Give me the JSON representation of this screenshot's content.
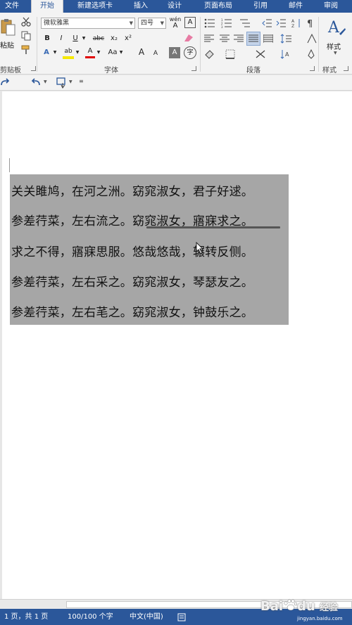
{
  "tabs": {
    "file": "文件",
    "home": "开始",
    "new_tab": "新建选项卡",
    "insert": "插入",
    "design": "设计",
    "layout": "页面布局",
    "references": "引用",
    "mailings": "邮件",
    "review": "审阅"
  },
  "ribbon": {
    "clipboard": {
      "paste_label": "粘贴",
      "group_label": "剪贴板"
    },
    "font": {
      "font_name": "微软雅黑",
      "font_size": "四号",
      "bold": "B",
      "italic": "I",
      "underline": "U",
      "strike": "abc",
      "subscript": "x₂",
      "superscript": "x²",
      "grow": "A",
      "shrink": "A",
      "clear": "A",
      "phonetic": "wén",
      "char_border": "A",
      "char_shading": "A",
      "enclose": "字",
      "font_color": "A",
      "highlight": "ab",
      "change_case": "Aa",
      "group_label": "字体"
    },
    "paragraph": {
      "group_label": "段落"
    },
    "styles": {
      "label": "样式",
      "group_label": "样式"
    }
  },
  "document": {
    "lines": [
      "关关雎鸠，在河之洲。窈窕淑女，君子好逑。",
      "参差荇菜，左右流之。窈窕淑女，寤寐求之。",
      "求之不得，寤寐思服。悠哉悠哉，辗转反侧。",
      "参差荇菜，左右采之。窈窕淑女，琴瑟友之。",
      "参差荇菜，左右芼之。窈窕淑女，钟鼓乐之。"
    ]
  },
  "status": {
    "page": "1 页，共 1 页",
    "words": "100/100 个字",
    "language": "中文(中国)"
  },
  "watermark": {
    "brand": "Bai",
    "brand2": "du",
    "experience": "经验",
    "url": "jingyan.baidu.com"
  },
  "colors": {
    "accent": "#2b579a",
    "selection": "#a6a6a6",
    "font_color_bar": "#e00000",
    "highlight_bar": "#f5e800"
  }
}
